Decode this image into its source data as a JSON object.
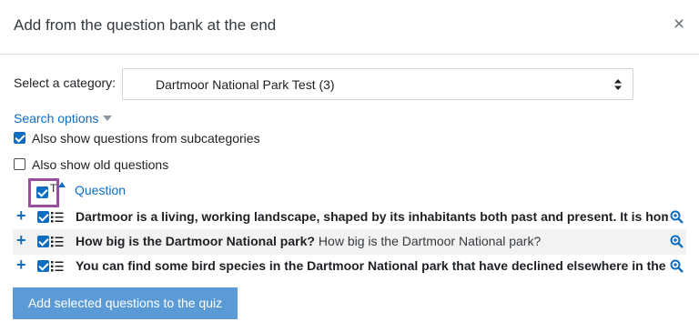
{
  "modal": {
    "title": "Add from the question bank at the end",
    "close_label": "×"
  },
  "category": {
    "label": "Select a category:",
    "selected": "Dartmoor National Park Test (3)"
  },
  "search_options": {
    "label": "Search options",
    "subcategories": {
      "label": "Also show questions from subcategories",
      "checked": true
    },
    "old_questions": {
      "label": "Also show old questions",
      "checked": false
    }
  },
  "table": {
    "sort_header": "T",
    "question_header": "Question",
    "select_all_checked": true,
    "rows": [
      {
        "name": "Dartmoor is a living, working landscape, shaped by its inhabitants both past and present. It is home to",
        "text": "",
        "checked": true
      },
      {
        "name": "How big is the Dartmoor National park?",
        "text": "How big is the Dartmoor National park?",
        "checked": true
      },
      {
        "name": "You can find some bird species in the Dartmoor National park that have declined elsewhere in the",
        "text": "",
        "checked": true
      }
    ]
  },
  "actions": {
    "submit_label": "Add selected questions to the quiz"
  },
  "colors": {
    "link": "#0f6cbf",
    "button": "#5b9bd5",
    "highlight": "#9b4d9e"
  }
}
